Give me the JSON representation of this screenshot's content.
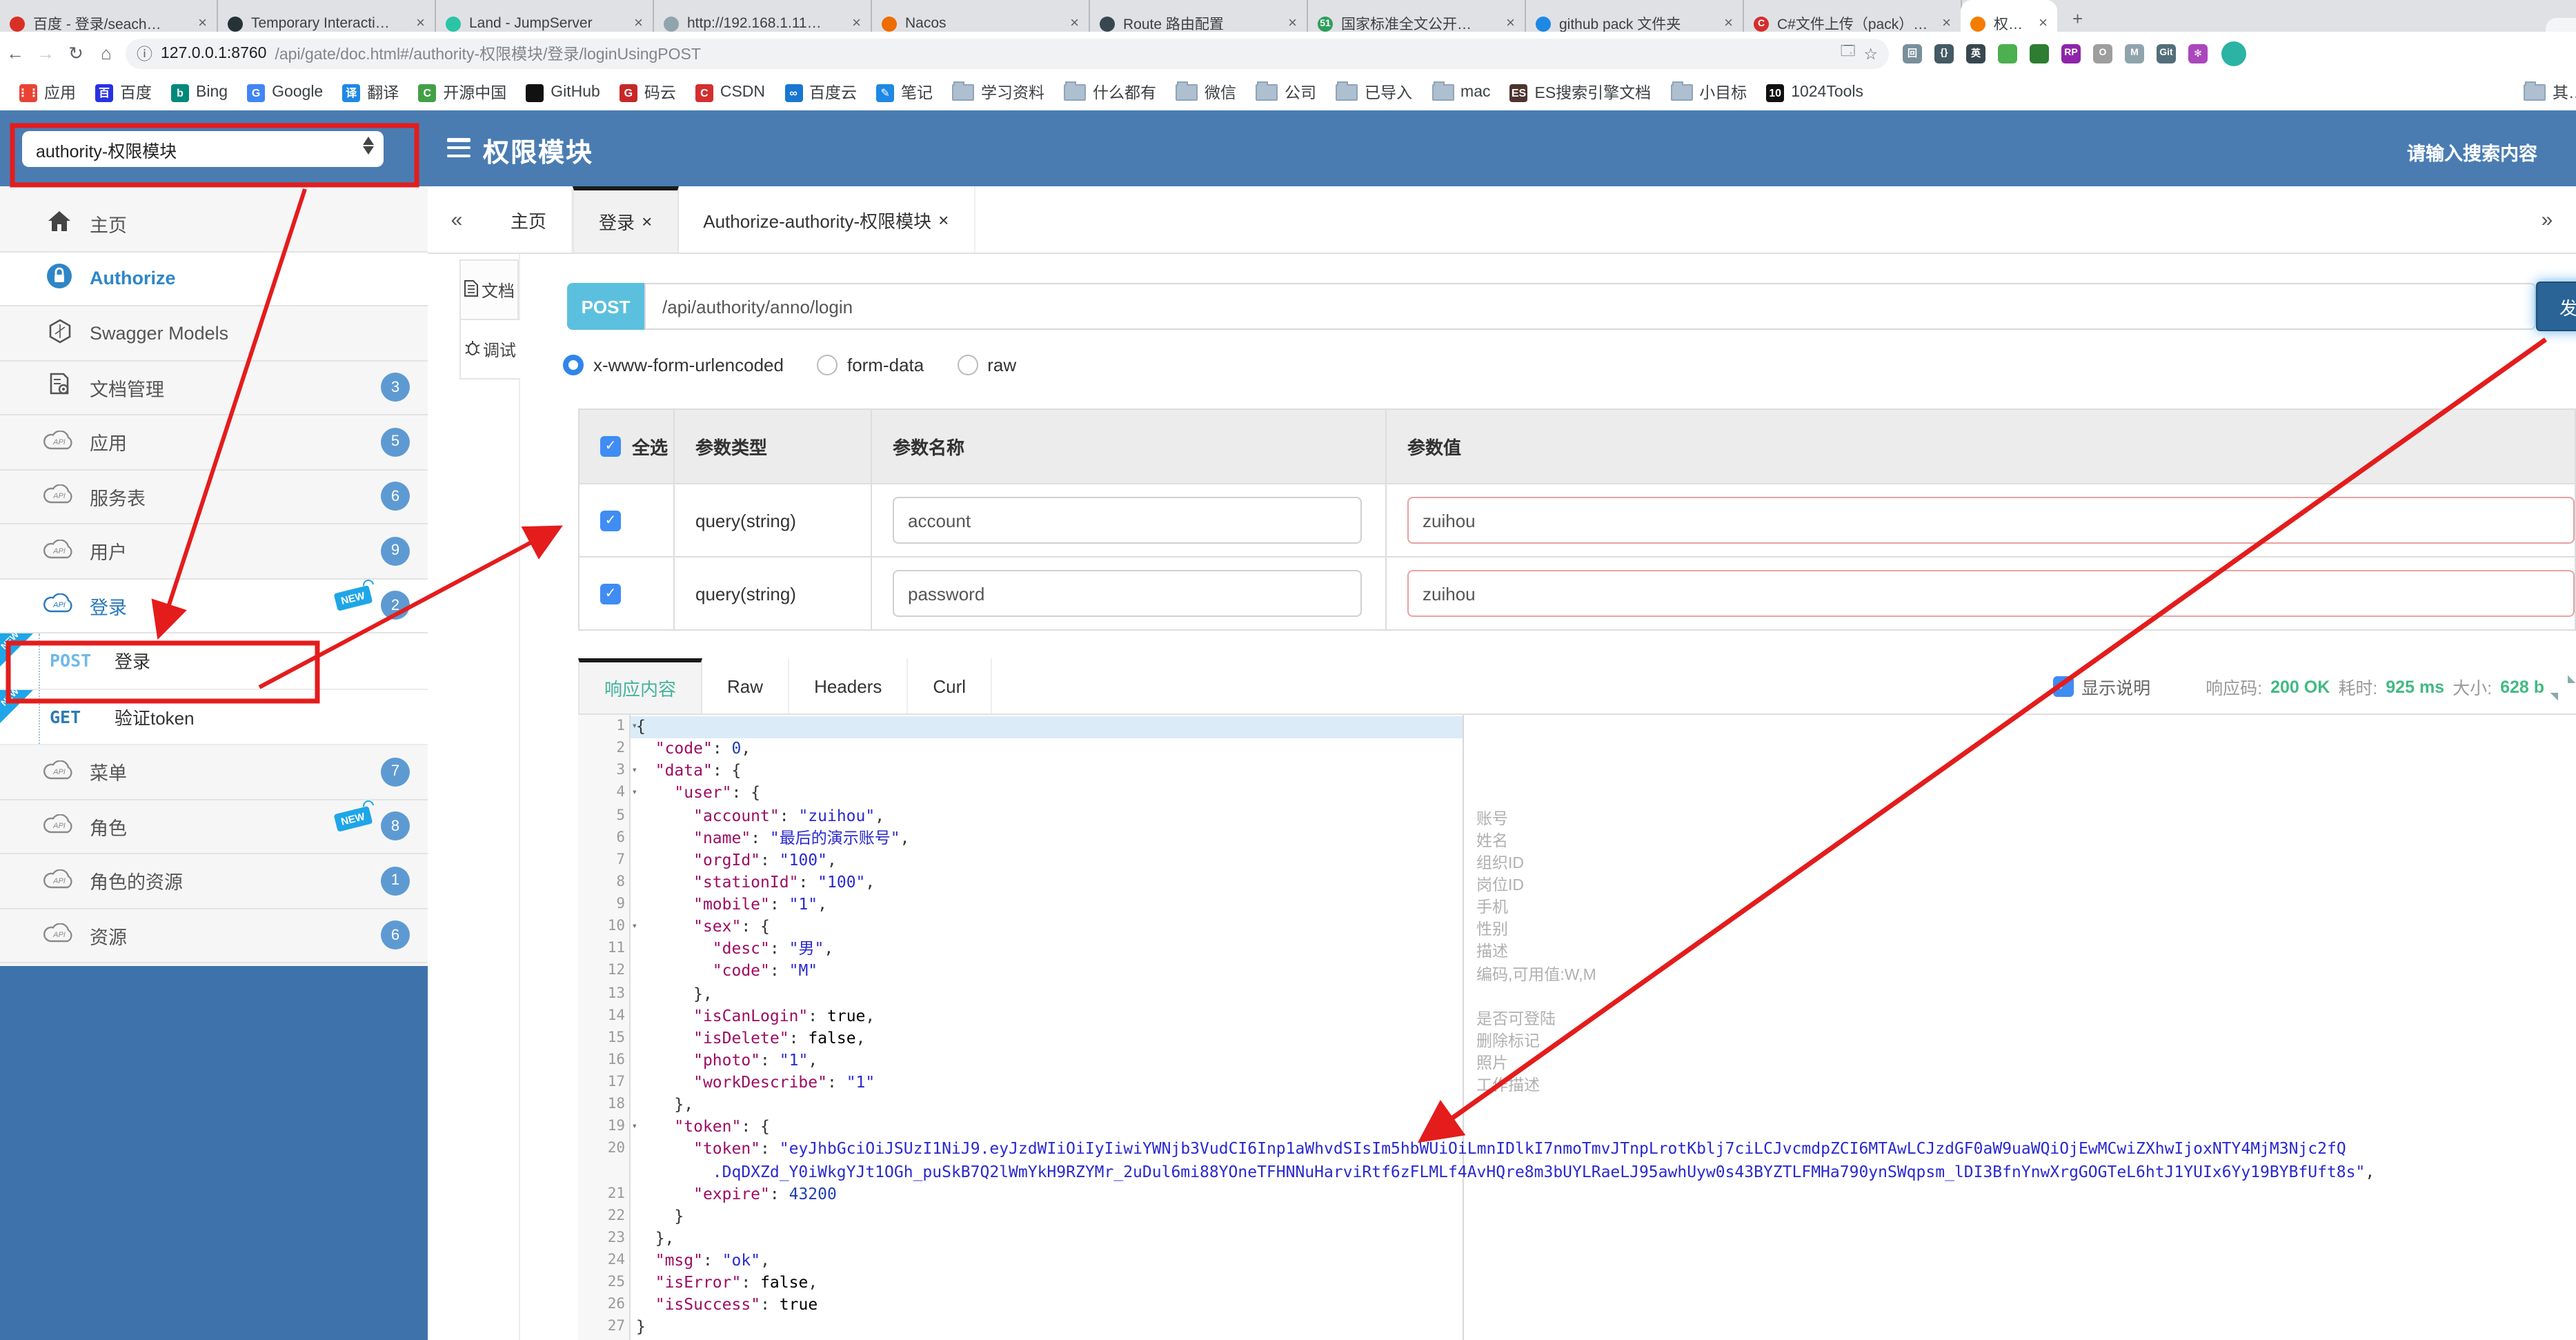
{
  "browser": {
    "tabs": [
      {
        "title": "百度 - 登录/seach…",
        "favicon": "baidu-tab-icon",
        "color": "#d93025",
        "glyph": ""
      },
      {
        "title": "Temporary Interacti…",
        "favicon": "temp-tab-icon",
        "color": "#263238",
        "glyph": ""
      },
      {
        "title": "Land - JumpServer",
        "favicon": "jumpserver-icon",
        "color": "#2bc4a6",
        "glyph": ""
      },
      {
        "title": "http://192.168.1.11…",
        "favicon": "globe-tab-icon",
        "color": "#90a4ae",
        "glyph": ""
      },
      {
        "title": "Nacos",
        "favicon": "nacos-icon",
        "color": "#ef6c00",
        "glyph": ""
      },
      {
        "title": "Route 路由配置",
        "favicon": "route-icon",
        "color": "#37474f",
        "glyph": ""
      },
      {
        "title": "国家标准全文公开…",
        "favicon": "std51-icon",
        "color": "#2e9e5b",
        "glyph": "51"
      },
      {
        "title": "github pack 文件夹",
        "favicon": "gitlab-icon",
        "color": "#1e88e5",
        "glyph": ""
      },
      {
        "title": "C#文件上传（pack）…",
        "favicon": "csdn-tab-icon",
        "color": "#d32f2f",
        "glyph": "C"
      }
    ],
    "active_tab": {
      "title": "权限模块",
      "favicon": "swagger-tab-icon",
      "color": "#f57c00",
      "close": "×"
    },
    "new_tab_label": "+",
    "url": {
      "host": "127.0.0.1:8760",
      "path": "/api/gate/doc.html#/authority-权限模块/登录/loginUsingPOST"
    },
    "extensions": [
      {
        "name": "reader-ext-icon",
        "color": "#78909c",
        "glyph": "回"
      },
      {
        "name": "json-brace-ext-icon",
        "color": "#455a64",
        "glyph": "{}"
      },
      {
        "name": "en-translate-ext-icon",
        "color": "#37474f",
        "glyph": "英"
      },
      {
        "name": "chrome-ext-icon",
        "color": "#4caf50",
        "glyph": ""
      },
      {
        "name": "globe-ext-icon",
        "color": "#2e7d32",
        "glyph": ""
      },
      {
        "name": "rp-ext-icon",
        "color": "#8e24aa",
        "glyph": "RP"
      },
      {
        "name": "oval-ext-icon",
        "color": "#9e9e9e",
        "glyph": "O"
      },
      {
        "name": "m-ext-icon",
        "color": "#90a4ae",
        "glyph": "M"
      },
      {
        "name": "gitzip-ext-icon",
        "color": "#546e7a",
        "glyph": "Git"
      },
      {
        "name": "pinwheel-ext-icon",
        "color": "#ab47bc",
        "glyph": "✻"
      }
    ],
    "bookmarks": [
      {
        "icon": "apps-grid-icon",
        "label": "应用",
        "color": "#ea4335",
        "glyph": "⋮⋮"
      },
      {
        "icon": "baidu-icon",
        "label": "百度",
        "color": "#2932e1",
        "glyph": "百"
      },
      {
        "icon": "bing-icon",
        "label": "Bing",
        "color": "#00897b",
        "glyph": "b"
      },
      {
        "icon": "google-icon",
        "label": "Google",
        "color": "#4285f4",
        "glyph": "G"
      },
      {
        "icon": "translate-icon",
        "label": "翻译",
        "color": "#1e88e5",
        "glyph": "译"
      },
      {
        "icon": "osc-icon",
        "label": "开源中国",
        "color": "#43a047",
        "glyph": "C"
      },
      {
        "icon": "github-icon",
        "label": "GitHub",
        "color": "#111111",
        "glyph": ""
      },
      {
        "icon": "gitee-icon",
        "label": "码云",
        "color": "#c62828",
        "glyph": "G"
      },
      {
        "icon": "csdn-icon",
        "label": "CSDN",
        "color": "#d32f2f",
        "glyph": "C"
      },
      {
        "icon": "baidupan-icon",
        "label": "百度云",
        "color": "#1976d2",
        "glyph": "∞"
      },
      {
        "icon": "note-icon",
        "label": "笔记",
        "color": "#1e88e5",
        "glyph": "✎"
      },
      {
        "icon": "folder-icon",
        "label": "学习资料",
        "color": "",
        "glyph": ""
      },
      {
        "icon": "folder-icon",
        "label": "什么都有",
        "color": "",
        "glyph": ""
      },
      {
        "icon": "folder-icon",
        "label": "微信",
        "color": "",
        "glyph": ""
      },
      {
        "icon": "folder-icon",
        "label": "公司",
        "color": "",
        "glyph": ""
      },
      {
        "icon": "folder-icon",
        "label": "已导入",
        "color": "",
        "glyph": ""
      },
      {
        "icon": "folder-icon",
        "label": "mac",
        "color": "",
        "glyph": ""
      },
      {
        "icon": "es-icon",
        "label": "ES搜索引擎文档",
        "color": "#4e342e",
        "glyph": "ES"
      },
      {
        "icon": "folder-icon",
        "label": "小目标",
        "color": "",
        "glyph": ""
      },
      {
        "icon": "tools1024-icon",
        "label": "1024Tools",
        "color": "#111111",
        "glyph": "10"
      }
    ],
    "bookmarks_overflow": {
      "icon": "folder-icon",
      "label": "其…"
    }
  },
  "header": {
    "module_select": "authority-权限模块",
    "title": "权限模块",
    "search_placeholder": "请输入搜索内容"
  },
  "sidebar": {
    "items": [
      {
        "kind": "item",
        "icon": "home-icon",
        "label": "主页"
      },
      {
        "kind": "item",
        "icon": "lock-icon",
        "label": "Authorize",
        "style": "auth",
        "white": true
      },
      {
        "kind": "item",
        "icon": "hexagon-icon",
        "label": "Swagger Models"
      },
      {
        "kind": "item",
        "icon": "doc-gear-icon",
        "label": "文档管理",
        "count": "3"
      },
      {
        "kind": "item",
        "icon": "cloud-api-icon",
        "label": "应用",
        "count": "5"
      },
      {
        "kind": "item",
        "icon": "cloud-api-icon",
        "label": "服务表",
        "count": "6"
      },
      {
        "kind": "item",
        "icon": "cloud-api-icon",
        "label": "用户",
        "count": "9"
      },
      {
        "kind": "group",
        "icon": "cloud-api-icon",
        "label": "登录",
        "count": "2",
        "new_flag": "NEW",
        "white": true
      },
      {
        "kind": "sub",
        "method": "POST",
        "label": "登录",
        "ribbon": "NEW",
        "highlighted": true
      },
      {
        "kind": "sub",
        "method": "GET",
        "label": "验证token",
        "ribbon": "NEW"
      },
      {
        "kind": "item",
        "icon": "cloud-api-icon",
        "label": "菜单",
        "count": "7"
      },
      {
        "kind": "item",
        "icon": "cloud-api-icon",
        "label": "角色",
        "count": "8",
        "new_flag": "NEW"
      },
      {
        "kind": "item",
        "icon": "cloud-api-icon",
        "label": "角色的资源",
        "count": "1"
      },
      {
        "kind": "item",
        "icon": "cloud-api-icon",
        "label": "资源",
        "count": "6"
      }
    ]
  },
  "main_tabs": {
    "collapse": "«",
    "expand": "»",
    "tabs": [
      {
        "label": "主页",
        "close": "",
        "active": false
      },
      {
        "label": "登录",
        "close": "×",
        "active": true
      },
      {
        "label": "Authorize-authority-权限模块",
        "close": "×",
        "active": false
      }
    ]
  },
  "doc_tabs": [
    {
      "label": "文档",
      "icon": "doc-icon",
      "active": false
    },
    {
      "label": "调试",
      "icon": "debug-icon",
      "active": true
    }
  ],
  "request": {
    "method": "POST",
    "url": "/api/authority/anno/login",
    "send_label": "发送",
    "body_types": [
      "x-www-form-urlencoded",
      "form-data",
      "raw"
    ],
    "body_type_selected": 0
  },
  "param_table": {
    "headers": [
      "全选",
      "参数类型",
      "参数名称",
      "参数值"
    ],
    "rows": [
      {
        "checked": true,
        "type": "query(string)",
        "name": "account",
        "value": "zuihou"
      },
      {
        "checked": true,
        "type": "query(string)",
        "name": "password",
        "value": "zuihou"
      }
    ]
  },
  "response": {
    "tabs": [
      "响应内容",
      "Raw",
      "Headers",
      "Curl"
    ],
    "active_tab": 0,
    "show_desc_label": "显示说明",
    "code_label": "响应码:",
    "code_value": "200 OK",
    "time_label": "耗时:",
    "time_value": "925 ms",
    "size_label": "大小:",
    "size_value": "628 b"
  },
  "code": {
    "active_line": 1,
    "lines": [
      {
        "n": "1",
        "fold": true,
        "segs": [
          [
            "pl",
            "{"
          ]
        ]
      },
      {
        "n": "2",
        "segs": [
          [
            "pl",
            "  "
          ],
          [
            "key",
            "\"code\""
          ],
          [
            "pl",
            ": "
          ],
          [
            "num",
            "0"
          ],
          [
            "pl",
            ","
          ]
        ]
      },
      {
        "n": "3",
        "fold": true,
        "segs": [
          [
            "pl",
            "  "
          ],
          [
            "key",
            "\"data\""
          ],
          [
            "pl",
            ": {"
          ]
        ]
      },
      {
        "n": "4",
        "fold": true,
        "segs": [
          [
            "pl",
            "    "
          ],
          [
            "key",
            "\"user\""
          ],
          [
            "pl",
            ": {"
          ]
        ]
      },
      {
        "n": "5",
        "segs": [
          [
            "pl",
            "      "
          ],
          [
            "key",
            "\"account\""
          ],
          [
            "pl",
            ": "
          ],
          [
            "str",
            "\"zuihou\""
          ],
          [
            "pl",
            ","
          ]
        ]
      },
      {
        "n": "6",
        "segs": [
          [
            "pl",
            "      "
          ],
          [
            "key",
            "\"name\""
          ],
          [
            "pl",
            ": "
          ],
          [
            "str",
            "\"最后的演示账号\""
          ],
          [
            "pl",
            ","
          ]
        ]
      },
      {
        "n": "7",
        "segs": [
          [
            "pl",
            "      "
          ],
          [
            "key",
            "\"orgId\""
          ],
          [
            "pl",
            ": "
          ],
          [
            "str",
            "\"100\""
          ],
          [
            "pl",
            ","
          ]
        ]
      },
      {
        "n": "8",
        "segs": [
          [
            "pl",
            "      "
          ],
          [
            "key",
            "\"stationId\""
          ],
          [
            "pl",
            ": "
          ],
          [
            "str",
            "\"100\""
          ],
          [
            "pl",
            ","
          ]
        ]
      },
      {
        "n": "9",
        "segs": [
          [
            "pl",
            "      "
          ],
          [
            "key",
            "\"mobile\""
          ],
          [
            "pl",
            ": "
          ],
          [
            "str",
            "\"1\""
          ],
          [
            "pl",
            ","
          ]
        ]
      },
      {
        "n": "10",
        "fold": true,
        "segs": [
          [
            "pl",
            "      "
          ],
          [
            "key",
            "\"sex\""
          ],
          [
            "pl",
            ": {"
          ]
        ]
      },
      {
        "n": "11",
        "segs": [
          [
            "pl",
            "        "
          ],
          [
            "key",
            "\"desc\""
          ],
          [
            "pl",
            ": "
          ],
          [
            "str",
            "\"男\""
          ],
          [
            "pl",
            ","
          ]
        ]
      },
      {
        "n": "12",
        "segs": [
          [
            "pl",
            "        "
          ],
          [
            "key",
            "\"code\""
          ],
          [
            "pl",
            ": "
          ],
          [
            "str",
            "\"M\""
          ]
        ]
      },
      {
        "n": "13",
        "segs": [
          [
            "pl",
            "      },"
          ]
        ]
      },
      {
        "n": "14",
        "segs": [
          [
            "pl",
            "      "
          ],
          [
            "key",
            "\"isCanLogin\""
          ],
          [
            "pl",
            ": "
          ],
          [
            "bool",
            "true"
          ],
          [
            "pl",
            ","
          ]
        ]
      },
      {
        "n": "15",
        "segs": [
          [
            "pl",
            "      "
          ],
          [
            "key",
            "\"isDelete\""
          ],
          [
            "pl",
            ": "
          ],
          [
            "bool",
            "false"
          ],
          [
            "pl",
            ","
          ]
        ]
      },
      {
        "n": "16",
        "segs": [
          [
            "pl",
            "      "
          ],
          [
            "key",
            "\"photo\""
          ],
          [
            "pl",
            ": "
          ],
          [
            "str",
            "\"1\""
          ],
          [
            "pl",
            ","
          ]
        ]
      },
      {
        "n": "17",
        "segs": [
          [
            "pl",
            "      "
          ],
          [
            "key",
            "\"workDescribe\""
          ],
          [
            "pl",
            ": "
          ],
          [
            "str",
            "\"1\""
          ]
        ]
      },
      {
        "n": "18",
        "segs": [
          [
            "pl",
            "    },"
          ]
        ]
      },
      {
        "n": "19",
        "fold": true,
        "segs": [
          [
            "pl",
            "    "
          ],
          [
            "key",
            "\"token\""
          ],
          [
            "pl",
            ": {"
          ]
        ]
      },
      {
        "n": "20",
        "segs": [
          [
            "pl",
            "      "
          ],
          [
            "key",
            "\"token\""
          ],
          [
            "pl",
            ": "
          ],
          [
            "str",
            "\"eyJhbGciOiJSUzI1NiJ9.eyJzdWIiOiIyIiwiYWNjb3VudCI6Inp1aWhvdSIsIm5hbWUiOiLmnIDlkI7nmoTmvJTnpLrotKblj7ciLCJvcmdpZCI6MTAwLCJzdGF0aW9uaWQiOjEwMCwiZXhwIjoxNTY4MjM3Njc2fQ"
          ]
        ]
      },
      {
        "n": "",
        "segs": [
          [
            "pl",
            "        "
          ],
          [
            "str",
            ".DqDXZd_Y0iWkgYJt1OGh_puSkB7Q2lWmYkH9RZYMr_2uDul6mi88YOneTFHNNuHarviRtf6zFLMLf4AvHQre8m3bUYLRaeLJ95awhUyw0s43BYZTLFMHa790ynSWqpsm_lDI3BfnYnwXrgGOGTeL6htJ1YUIx6Yy19BYBfUft8s\""
          ],
          [
            "pl",
            ","
          ]
        ]
      },
      {
        "n": "21",
        "segs": [
          [
            "pl",
            "      "
          ],
          [
            "key",
            "\"expire\""
          ],
          [
            "pl",
            ": "
          ],
          [
            "num",
            "43200"
          ]
        ]
      },
      {
        "n": "22",
        "segs": [
          [
            "pl",
            "    }"
          ]
        ]
      },
      {
        "n": "23",
        "segs": [
          [
            "pl",
            "  },"
          ]
        ]
      },
      {
        "n": "24",
        "segs": [
          [
            "pl",
            "  "
          ],
          [
            "key",
            "\"msg\""
          ],
          [
            "pl",
            ": "
          ],
          [
            "str",
            "\"ok\""
          ],
          [
            "pl",
            ","
          ]
        ]
      },
      {
        "n": "25",
        "segs": [
          [
            "pl",
            "  "
          ],
          [
            "key",
            "\"isError\""
          ],
          [
            "pl",
            ": "
          ],
          [
            "bool",
            "false"
          ],
          [
            "pl",
            ","
          ]
        ]
      },
      {
        "n": "26",
        "segs": [
          [
            "pl",
            "  "
          ],
          [
            "key",
            "\"isSuccess\""
          ],
          [
            "pl",
            ": "
          ],
          [
            "bool",
            "true"
          ]
        ]
      },
      {
        "n": "27",
        "segs": [
          [
            "pl",
            "}"
          ]
        ]
      }
    ],
    "field_notes": [
      {
        "line": 5,
        "text": "账号"
      },
      {
        "line": 6,
        "text": "姓名"
      },
      {
        "line": 7,
        "text": "组织ID"
      },
      {
        "line": 8,
        "text": "岗位ID"
      },
      {
        "line": 9,
        "text": "手机"
      },
      {
        "line": 10,
        "text": "性别"
      },
      {
        "line": 11,
        "text": "描述"
      },
      {
        "line": 12,
        "text": "编码,可用值:W,M"
      },
      {
        "line": 14,
        "text": "是否可登陆"
      },
      {
        "line": 15,
        "text": "删除标记"
      },
      {
        "line": 16,
        "text": "照片"
      },
      {
        "line": 17,
        "text": "工作描述"
      }
    ]
  },
  "colors": {
    "header_blue": "#4a7cb2",
    "sidebar_blue": "#3d73aa",
    "post_badge": "#5bc0de",
    "send_button": "#2a6496",
    "success_green": "#42b983",
    "annotation_red": "#e41c1c",
    "check_blue": "#3f8cf3"
  },
  "annotations": [
    "module-select-highlight-box",
    "post-login-highlight-box",
    "arrow-select-to-login-api",
    "arrow-login-api-to-params",
    "arrow-send-button-to-token"
  ]
}
